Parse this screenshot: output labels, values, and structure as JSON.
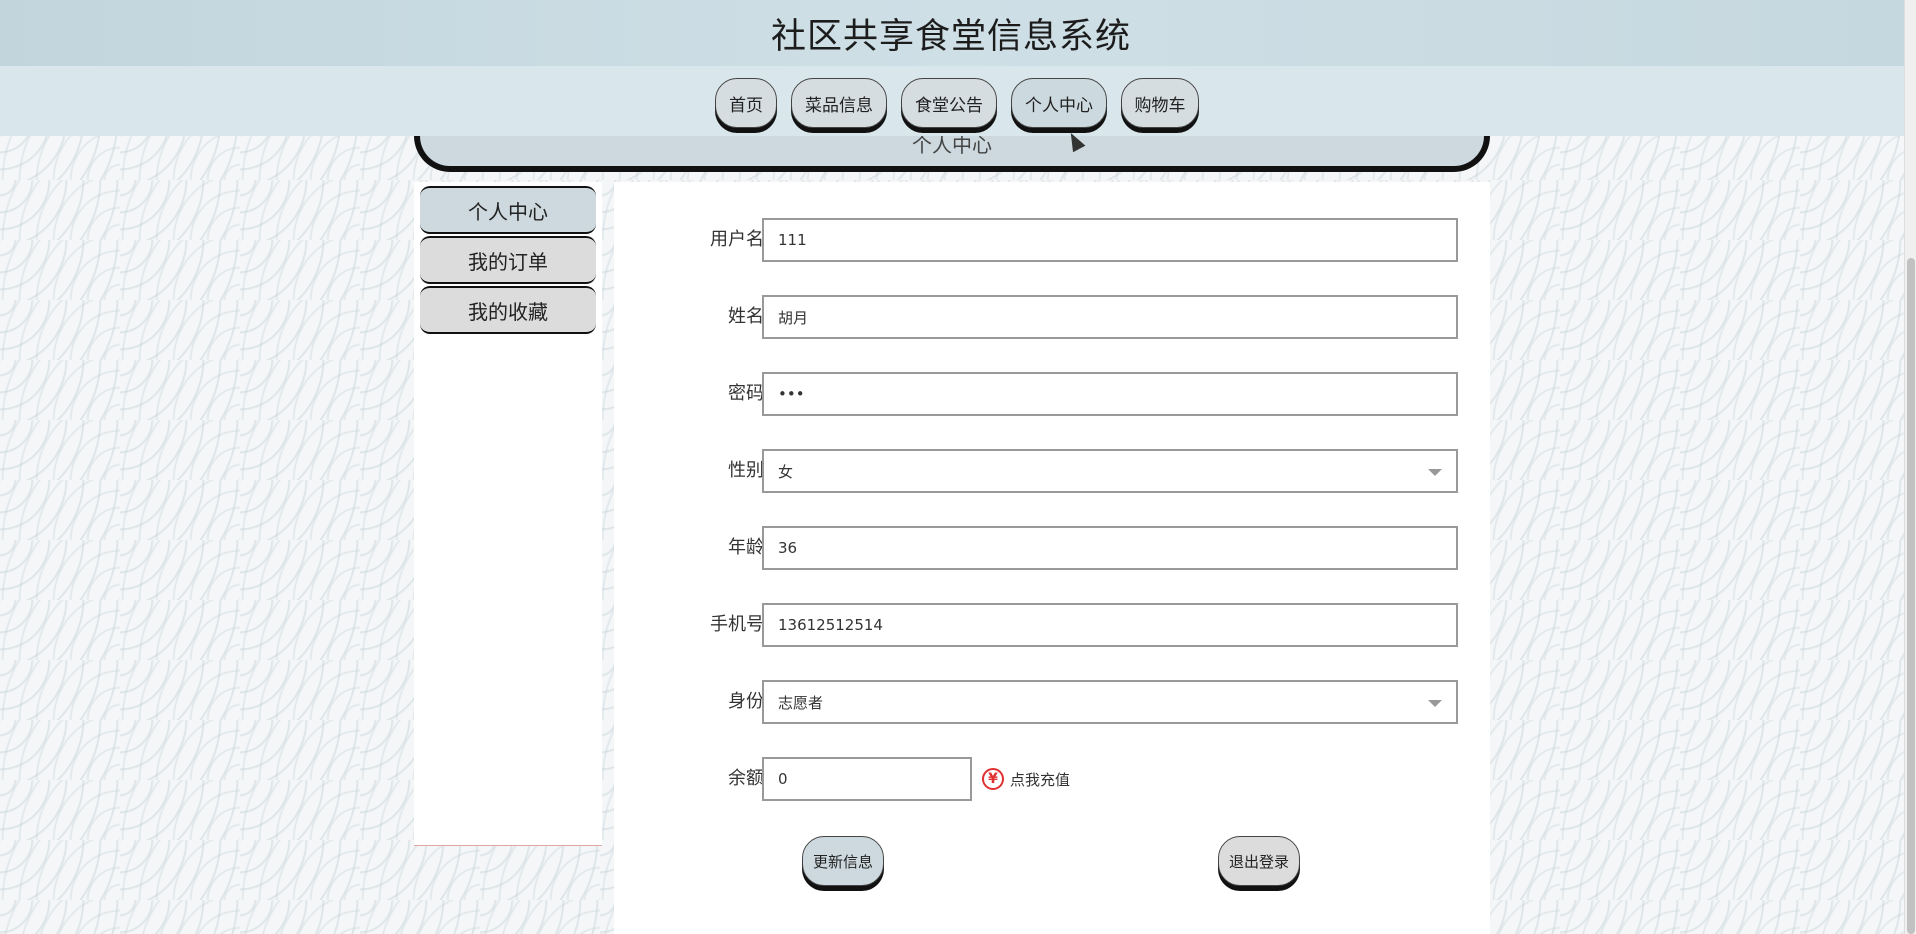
{
  "header": {
    "title": "社区共享食堂信息系统"
  },
  "nav": {
    "items": [
      {
        "label": "首页"
      },
      {
        "label": "菜品信息"
      },
      {
        "label": "食堂公告"
      },
      {
        "label": "个人中心"
      },
      {
        "label": "购物车"
      }
    ],
    "active": "个人中心"
  },
  "page_title": "个人中心",
  "sidebar": {
    "items": [
      {
        "label": "个人中心"
      },
      {
        "label": "我的订单"
      },
      {
        "label": "我的收藏"
      }
    ]
  },
  "form": {
    "username": {
      "label": "用户名",
      "value": "111"
    },
    "name": {
      "label": "姓名",
      "value": "胡月"
    },
    "password": {
      "label": "密码",
      "value": "•••"
    },
    "gender": {
      "label": "性别",
      "value": "女"
    },
    "age": {
      "label": "年龄",
      "value": "36"
    },
    "phone": {
      "label": "手机号",
      "value": "13612512514"
    },
    "identity": {
      "label": "身份",
      "value": "志愿者"
    },
    "balance": {
      "label": "余额",
      "value": "0"
    },
    "recharge_label": "点我充值",
    "recharge_icon": "¥"
  },
  "actions": {
    "update_label": "更新信息",
    "logout_label": "退出登录"
  },
  "colors": {
    "header_bg": "#cfdfe6",
    "nav_bg": "#d9e6ec",
    "active_bg": "#cdd9de",
    "button_bg": "#dcdcdc",
    "accent_red": "#e03030"
  }
}
